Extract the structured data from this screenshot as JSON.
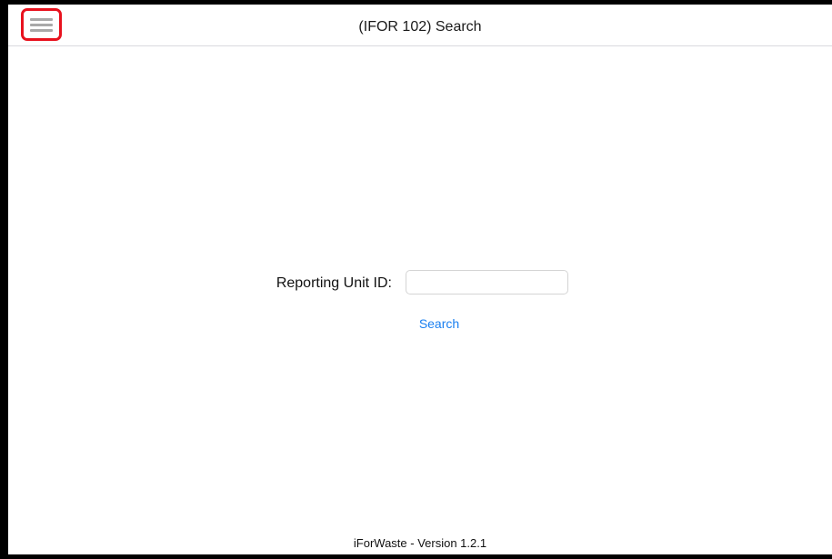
{
  "header": {
    "title": "(IFOR 102) Search",
    "menu_icon": "hamburger-menu-icon",
    "menu_highlight_color": "#e8121e"
  },
  "form": {
    "label": "Reporting Unit ID:",
    "input_value": "",
    "input_placeholder": "",
    "search_label": "Search",
    "accent_color": "#1a7ff0"
  },
  "footer": {
    "version_text": "iForWaste - Version 1.2.1"
  }
}
